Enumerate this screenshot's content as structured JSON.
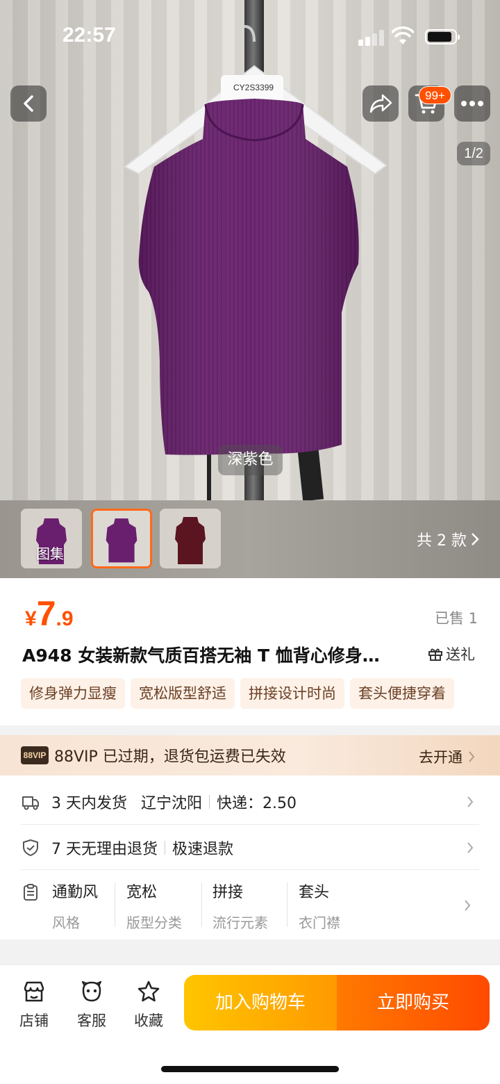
{
  "status_bar": {
    "time": "22:57"
  },
  "gallery": {
    "page_indicator": "1/2",
    "color_label": "深紫色",
    "cart_badge": "99+",
    "hanger_tag": "CY2S3399",
    "gallery_label": "图集",
    "styles_count_label": "共 2 款"
  },
  "product": {
    "price_currency": "¥",
    "price_integer": "7",
    "price_decimal": ".9",
    "sold_count": "已售 1",
    "title": "A948 女装新款气质百搭无袖 T 恤背心修身…",
    "gift_label": "送礼",
    "tags": [
      "修身弹力显瘦",
      "宽松版型舒适",
      "拼接设计时尚",
      "套头便捷穿着"
    ]
  },
  "vip_banner": {
    "badge": "88VIP",
    "text": "88VIP 已过期，退货包运费已失效",
    "action": "去开通"
  },
  "details": {
    "shipping": {
      "dispatch": "3 天内发货",
      "location": "辽宁沈阳",
      "express": "快递：2.50"
    },
    "returns": {
      "policy": "7 天无理由退货",
      "refund": "极速退款"
    },
    "attributes": [
      {
        "value": "通勤风",
        "key": "风格"
      },
      {
        "value": "宽松",
        "key": "版型分类"
      },
      {
        "value": "拼接",
        "key": "流行元素"
      },
      {
        "value": "套头",
        "key": "衣门襟"
      }
    ]
  },
  "bottom_bar": {
    "store_label": "店铺",
    "service_label": "客服",
    "favorite_label": "收藏",
    "add_to_cart_label": "加入购物车",
    "buy_now_label": "立即购买"
  },
  "colors": {
    "accent": "#ff5000",
    "garment": "#6a1f6e",
    "garment_dark": "#5a1a5e",
    "second_style": "#5a1520"
  }
}
